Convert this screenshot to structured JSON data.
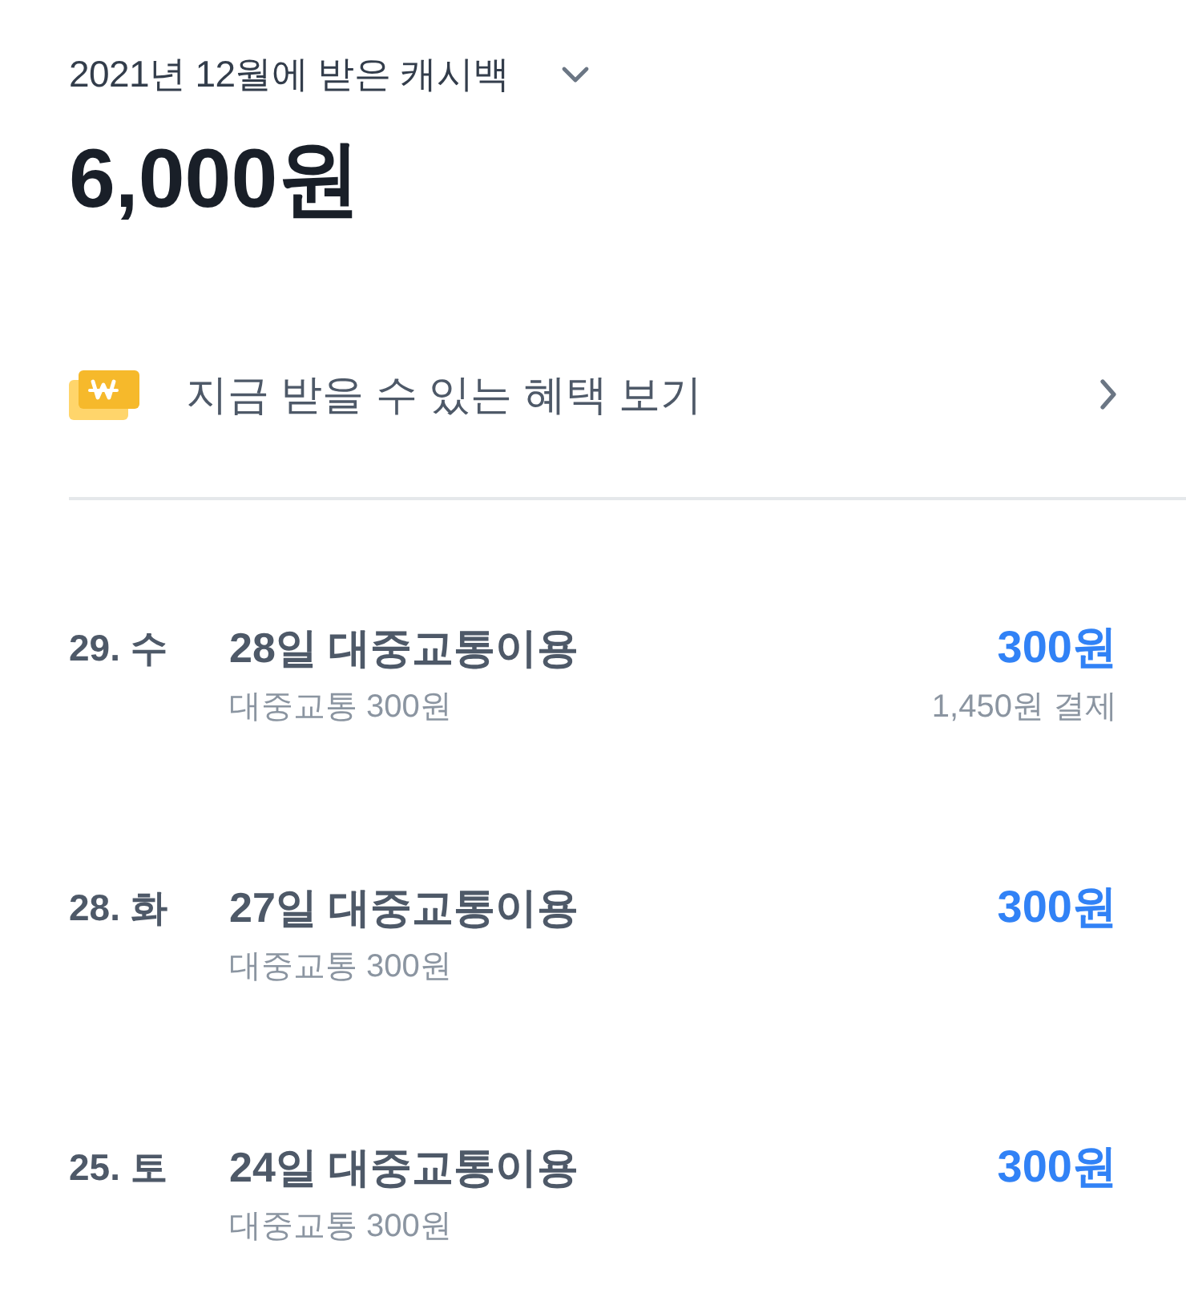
{
  "header": {
    "title": "2021년 12월에 받은 캐시백",
    "total": "6,000원"
  },
  "benefit": {
    "label": "지금 받을 수 있는 혜택 보기"
  },
  "transactions": [
    {
      "date": "29. 수",
      "title": "28일 대중교통이용",
      "detail": "대중교통 300원",
      "cashback": "300원",
      "payment": "1,450원 결제"
    },
    {
      "date": "28. 화",
      "title": "27일 대중교통이용",
      "detail": "대중교통 300원",
      "cashback": "300원"
    },
    {
      "date": "25. 토",
      "title": "24일 대중교통이용",
      "detail": "대중교통 300원",
      "cashback": "300원"
    }
  ]
}
